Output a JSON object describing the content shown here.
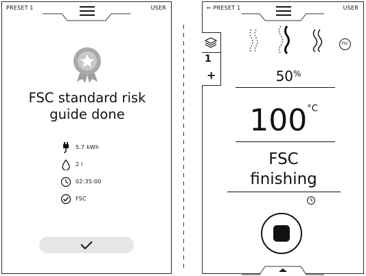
{
  "left_screen": {
    "preset_label": "PRESET 1",
    "user_label": "USER",
    "title_line1": "FSC standard risk",
    "title_line2": "guide done",
    "stats": [
      {
        "icon": "plug-icon",
        "value": "5.7 kWh"
      },
      {
        "icon": "water-drop-icon",
        "value": "2 l"
      },
      {
        "icon": "clock-icon",
        "value": "02:35:00"
      },
      {
        "icon": "check-circle-icon",
        "value": "FSC"
      }
    ]
  },
  "right_screen": {
    "back_preset_label": "← PRESET 1",
    "user_label": "USER",
    "side_value": "1",
    "side_plus": "+",
    "fsc_badge": "FSC",
    "humidity_value": "50",
    "humidity_unit": "%",
    "temperature_value": "100",
    "temperature_unit": "°C",
    "mode_line1": "FSC",
    "mode_line2": "finishing"
  },
  "colors": {
    "accent": "#111111",
    "muted": "#9e9e9e",
    "pill": "#e6e6e6"
  }
}
